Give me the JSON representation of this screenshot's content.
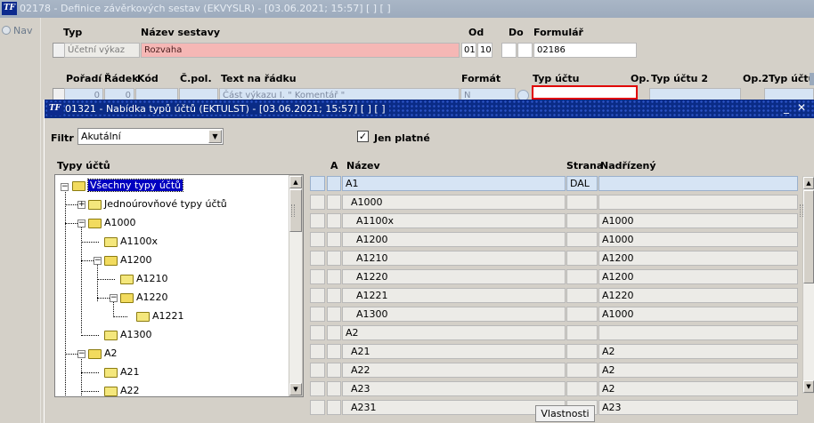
{
  "main_window": {
    "title": "02178 - Definice závěrkových sestav (EKVYSLR) - [03.06.2021; 15:57]  [ ]  [ ]",
    "nav_label": "Nav",
    "header_labels": {
      "typ": "Typ",
      "nazev_sestavy": "Název sestavy",
      "od": "Od",
      "do": "Do",
      "formular": "Formulář"
    },
    "typ_value": "Účetní výkaz",
    "nazev_value": "Rozvaha",
    "od_value": "01",
    "od_value2": "10",
    "formular_value": "02186",
    "column_labels": {
      "poradi": "Pořadí",
      "radek": "Řádek",
      "kod": "Kód",
      "cpol": "Č.pol.",
      "text": "Text na řádku",
      "format": "Formát",
      "typ_uctu": "Typ účtu",
      "op": "Op.",
      "typ_uctu2": "Typ účtu 2",
      "op2": "Op.2",
      "typ_uctu3": "Typ účtu"
    },
    "row_poradi": "0",
    "row_radek": "0",
    "row_text": "Část výkazu I. \" Komentář \"",
    "row_format": "N"
  },
  "dialog": {
    "title": "01321 - Nabídka typů účtů (EKTULST) - [03.06.2021; 15:57]  [ ]  [ ]",
    "filter_label": "Filtr",
    "filter_value": "Akutální",
    "only_valid_label": "Jen platné",
    "only_valid_checked": true,
    "tree_header": "Typy účtů",
    "tree": {
      "root": "Všechny typy účtů",
      "n1": "Jednoúrovňové typy účtů",
      "n2": "A1000",
      "n3": "A1100x",
      "n4": "A1200",
      "n5": "A1210",
      "n6": "A1220",
      "n7": "A1221",
      "n8": "A1300",
      "n9": "A2",
      "n10": "A21",
      "n11": "A22"
    },
    "grid_headers": {
      "a": "A",
      "nazev": "Název",
      "strana": "Strana",
      "nadrizeny": "Nadřízený"
    },
    "rows": [
      {
        "nazev": "A1",
        "strana": "DAL",
        "nadrizeny": ""
      },
      {
        "nazev": "A1000",
        "strana": "",
        "nadrizeny": ""
      },
      {
        "nazev": "A1100x",
        "strana": "",
        "nadrizeny": "A1000"
      },
      {
        "nazev": "A1200",
        "strana": "",
        "nadrizeny": "A1000"
      },
      {
        "nazev": "A1210",
        "strana": "",
        "nadrizeny": "A1200"
      },
      {
        "nazev": "A1220",
        "strana": "",
        "nadrizeny": "A1200"
      },
      {
        "nazev": "A1221",
        "strana": "",
        "nadrizeny": "A1220"
      },
      {
        "nazev": "A1300",
        "strana": "",
        "nadrizeny": "A1000"
      },
      {
        "nazev": "A2",
        "strana": "",
        "nadrizeny": ""
      },
      {
        "nazev": "A21",
        "strana": "",
        "nadrizeny": "A2"
      },
      {
        "nazev": "A22",
        "strana": "",
        "nadrizeny": "A2"
      },
      {
        "nazev": "A23",
        "strana": "",
        "nadrizeny": "A2"
      },
      {
        "nazev": "A231",
        "strana": "",
        "nadrizeny": "A23"
      }
    ],
    "properties_button": "Vlastnosti"
  },
  "colors": {
    "title_active": "#0a2b86",
    "title_inactive": "#a9b6c6",
    "highlight_border": "#e00000",
    "selection": "#0000c0"
  },
  "icons": [
    "app-logo-icon",
    "folder-icon",
    "folder-open-icon",
    "expand-icon",
    "collapse-icon",
    "dropdown-arrow-icon",
    "checkbox-icon",
    "minimize-icon",
    "close-icon"
  ]
}
